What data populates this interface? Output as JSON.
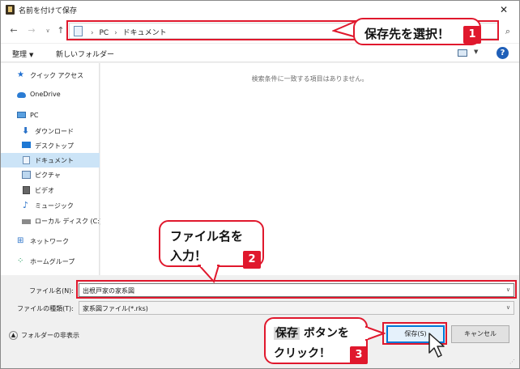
{
  "window": {
    "title": "名前を付けて保存",
    "close_glyph": "✕"
  },
  "nav": {
    "back_glyph": "←",
    "forward_glyph": "→",
    "history_glyph": "∨",
    "up_glyph": "↑",
    "address_crumbs": [
      "PC",
      "ドキュメント"
    ],
    "search_glyph": "⌕"
  },
  "toolbar": {
    "organize_label": "整理",
    "new_folder_label": "新しいフォルダー"
  },
  "navpane": {
    "items": [
      {
        "label": "クイック アクセス",
        "icon": "star-icon"
      },
      {
        "label": "OneDrive",
        "icon": "cloud-icon"
      },
      {
        "label": "PC",
        "icon": "pc-icon"
      },
      {
        "label": "ダウンロード",
        "icon": "download-icon"
      },
      {
        "label": "デスクトップ",
        "icon": "desktop-icon"
      },
      {
        "label": "ドキュメント",
        "icon": "document-icon",
        "selected": true
      },
      {
        "label": "ピクチャ",
        "icon": "picture-icon"
      },
      {
        "label": "ビデオ",
        "icon": "video-icon"
      },
      {
        "label": "ミュージック",
        "icon": "music-icon"
      },
      {
        "label": "ローカル ディスク (C:)",
        "icon": "drive-icon"
      },
      {
        "label": "ネットワーク",
        "icon": "network-icon"
      },
      {
        "label": "ホームグループ",
        "icon": "homegroup-icon"
      }
    ]
  },
  "content": {
    "empty_message": "検索条件に一致する項目はありません。"
  },
  "fields": {
    "filename_label": "ファイル名(N):",
    "filename_value": "出根戸家の家系図",
    "filetype_label": "ファイルの種類(T):",
    "filetype_value": "家系図ファイル(*.rks)"
  },
  "footer": {
    "hide_folders_label": "フォルダーの非表示",
    "save_button": "保存(S)",
    "cancel_button": "キャンセル"
  },
  "annotations": {
    "step1": {
      "text": "保存先を選択！",
      "badge": "1"
    },
    "step2": {
      "line1": "ファイル名を",
      "line2": "入力！",
      "badge": "2"
    },
    "step3": {
      "highlight": "保存",
      "line1_rest": " ボタンを",
      "line2": "クリック！",
      "badge": "3"
    }
  },
  "colors": {
    "accent_red": "#e0182d",
    "selection_blue": "#cce4f7",
    "save_border": "#0078d7"
  }
}
